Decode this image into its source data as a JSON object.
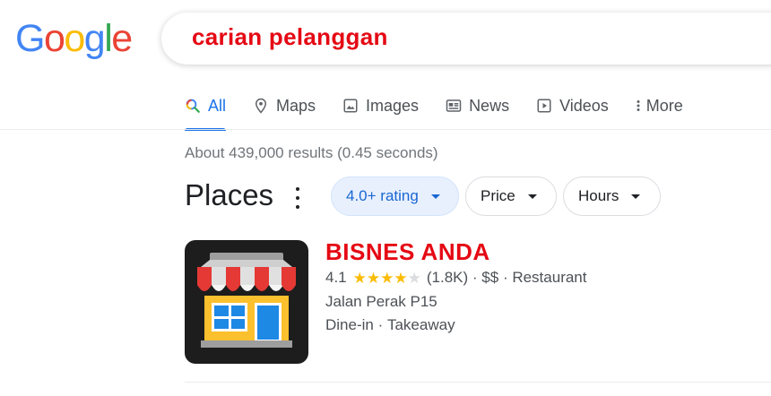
{
  "logo": {
    "letters": [
      "G",
      "o",
      "o",
      "g",
      "l",
      "e"
    ],
    "colors": [
      "#4285f4",
      "#ea4335",
      "#fbbc05",
      "#4285f4",
      "#34a853",
      "#ea4335"
    ]
  },
  "search": {
    "query": "carian pelanggan",
    "query_color": "#e50914"
  },
  "tabs": [
    {
      "label": "All",
      "icon": "search-icon",
      "active": true
    },
    {
      "label": "Maps",
      "icon": "map-pin-icon"
    },
    {
      "label": "Images",
      "icon": "image-icon"
    },
    {
      "label": "News",
      "icon": "news-icon"
    },
    {
      "label": "Videos",
      "icon": "video-icon"
    },
    {
      "label": "More",
      "icon": "more-vert-icon"
    }
  ],
  "results": {
    "stats": "About 439,000 results (0.45 seconds)"
  },
  "places": {
    "title": "Places",
    "chips": [
      {
        "label": "4.0+ rating",
        "selected": true
      },
      {
        "label": "Price"
      },
      {
        "label": "Hours"
      }
    ],
    "listing": {
      "name": "BISNES ANDA",
      "name_color": "#e50914",
      "rating": "4.1",
      "rating_stars": 4,
      "reviews": "(1.8K)",
      "price": "$$",
      "category": "Restaurant",
      "address": "Jalan Perak P15",
      "service_options": [
        "Dine-in",
        "Takeaway"
      ],
      "thumbnail_icon": "storefront-icon"
    }
  },
  "colors": {
    "accent": "#1a73e8",
    "chip_selected_bg": "#e8f0fe",
    "star": "#fbbc04"
  }
}
